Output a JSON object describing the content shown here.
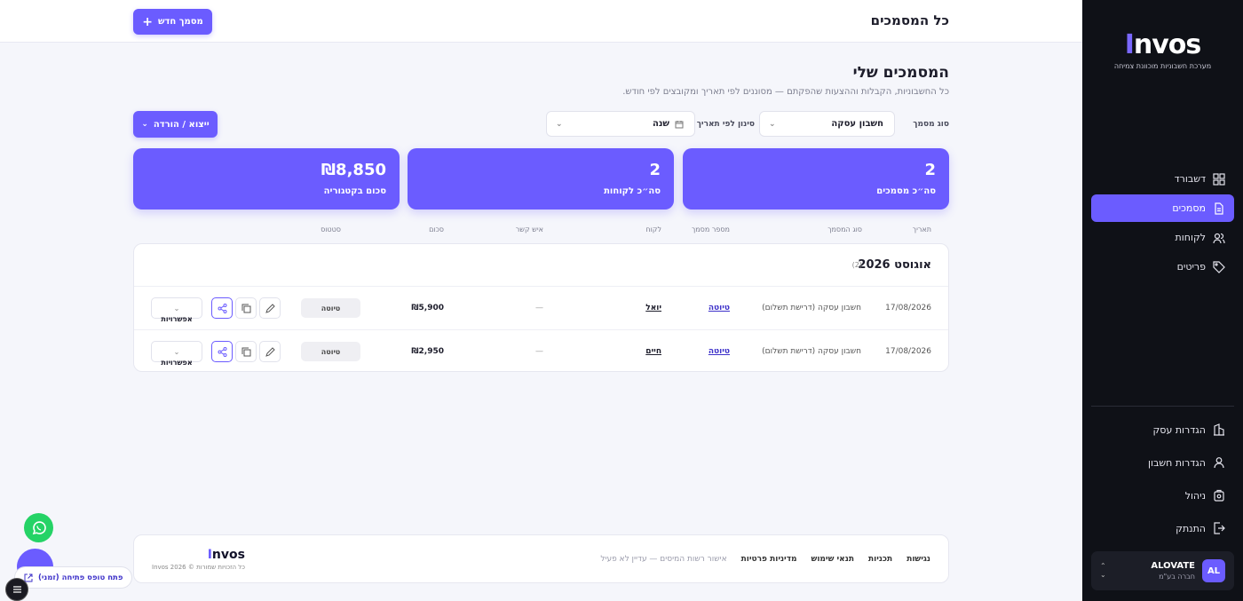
{
  "sidebar": {
    "logo": "nvos",
    "logo_prefix": "I",
    "tagline": "מערכת חשבוניות מוכוונת צמיחה",
    "nav": [
      {
        "label": "דשבורד",
        "icon": "grid-icon"
      },
      {
        "label": "מסמכים",
        "icon": "document-icon"
      },
      {
        "label": "לקוחות",
        "icon": "users-icon"
      },
      {
        "label": "פריטים",
        "icon": "tag-icon"
      }
    ],
    "nav_bottom": [
      {
        "label": "הגדרות עסק",
        "icon": "building-icon"
      },
      {
        "label": "הגדרות חשבון",
        "icon": "user-icon"
      },
      {
        "label": "ניהול",
        "icon": "lock-icon"
      },
      {
        "label": "התנתק",
        "icon": "logout-icon"
      }
    ],
    "account": {
      "initials": "AL",
      "name": "ALOVATE",
      "type": "חברה בע\"מ"
    }
  },
  "topbar": {
    "title": "כל המסמכים",
    "new_doc_label": "מסמך חדש"
  },
  "page": {
    "title": "המסמכים שלי",
    "subtitle": "כל החשבוניות, הקבלות וההצעות שהפקתם — מסוננים לפי תאריך ומקובצים לפי חודש."
  },
  "filters": {
    "doc_type_label": "סוג מסמך",
    "doc_type_value": "חשבון עסקה",
    "date_label": "סינון לפי תאריך",
    "date_value": "שנה",
    "export_label": "ייצוא / הורדה"
  },
  "stats": [
    {
      "value": "2",
      "label": "סה״כ מסמכים"
    },
    {
      "value": "2",
      "label": "סה״כ לקוחות"
    },
    {
      "value": "₪8,850",
      "label": "סכום בקטגוריה"
    }
  ],
  "table": {
    "columns": [
      "תאריך",
      "סוג המסמך",
      "מספר מסמך",
      "לקוח",
      "איש קשר",
      "סכום",
      "סטטוס"
    ],
    "group": {
      "title": "אוגוסט 2026",
      "count": "(2)"
    },
    "rows": [
      {
        "date": "17/08/2026",
        "type": "חשבון עסקה (דרישת תשלום)",
        "number": "טיוטה",
        "client": "יואל",
        "contact": "—",
        "amount": "₪5,900",
        "status": "טיוטה",
        "options": "אפשרויות"
      },
      {
        "date": "17/08/2026",
        "type": "חשבון עסקה (דרישת תשלום)",
        "number": "טיוטה",
        "client": "חיים",
        "contact": "—",
        "amount": "₪2,950",
        "status": "טיוטה",
        "options": "אפשרויות"
      }
    ]
  },
  "footer": {
    "links": [
      "נגישות",
      "תכניות",
      "תנאי שימוש",
      "מדיניות פרטיות"
    ],
    "note": "אישור רשות המיסים — עדיין לא פעיל",
    "logo": "nvos",
    "logo_prefix": "I",
    "copyright": "כל הזכויות שמורות © Invos 2026"
  },
  "fab": {
    "pill_label": "פתח טופס פתיחה (זמני)"
  },
  "colors": {
    "accent": "#6b5cff",
    "sidebar_bg": "#0f1117",
    "whatsapp": "#25d366"
  }
}
